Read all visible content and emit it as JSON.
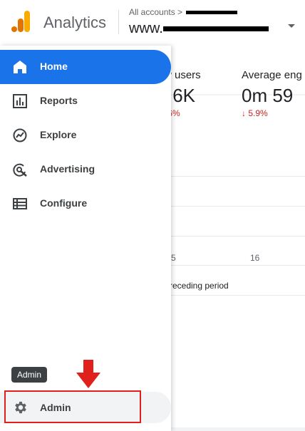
{
  "header": {
    "app_name": "Analytics",
    "account_crumb": "All accounts >",
    "property_name": "www."
  },
  "nav": {
    "items": [
      {
        "label": "Home",
        "icon": "home-icon",
        "active": true
      },
      {
        "label": "Reports",
        "icon": "bar-chart-icon",
        "active": false
      },
      {
        "label": "Explore",
        "icon": "explore-icon",
        "active": false
      },
      {
        "label": "Advertising",
        "icon": "advertising-icon",
        "active": false
      },
      {
        "label": "Configure",
        "icon": "list-icon",
        "active": false
      }
    ],
    "admin_label": "Admin",
    "admin_tooltip": "Admin"
  },
  "main": {
    "metric_a": {
      "label": "w users",
      "value": ".6K",
      "change": ".6%"
    },
    "metric_b": {
      "label": "Average eng",
      "value": "0m 59",
      "change": "↓ 5.9%"
    },
    "x_ticks": [
      "5",
      "16"
    ],
    "legend_text": "receding period"
  },
  "colors": {
    "accent": "#1a73e8",
    "decline": "#c5221f",
    "annotation": "#e0201c"
  }
}
